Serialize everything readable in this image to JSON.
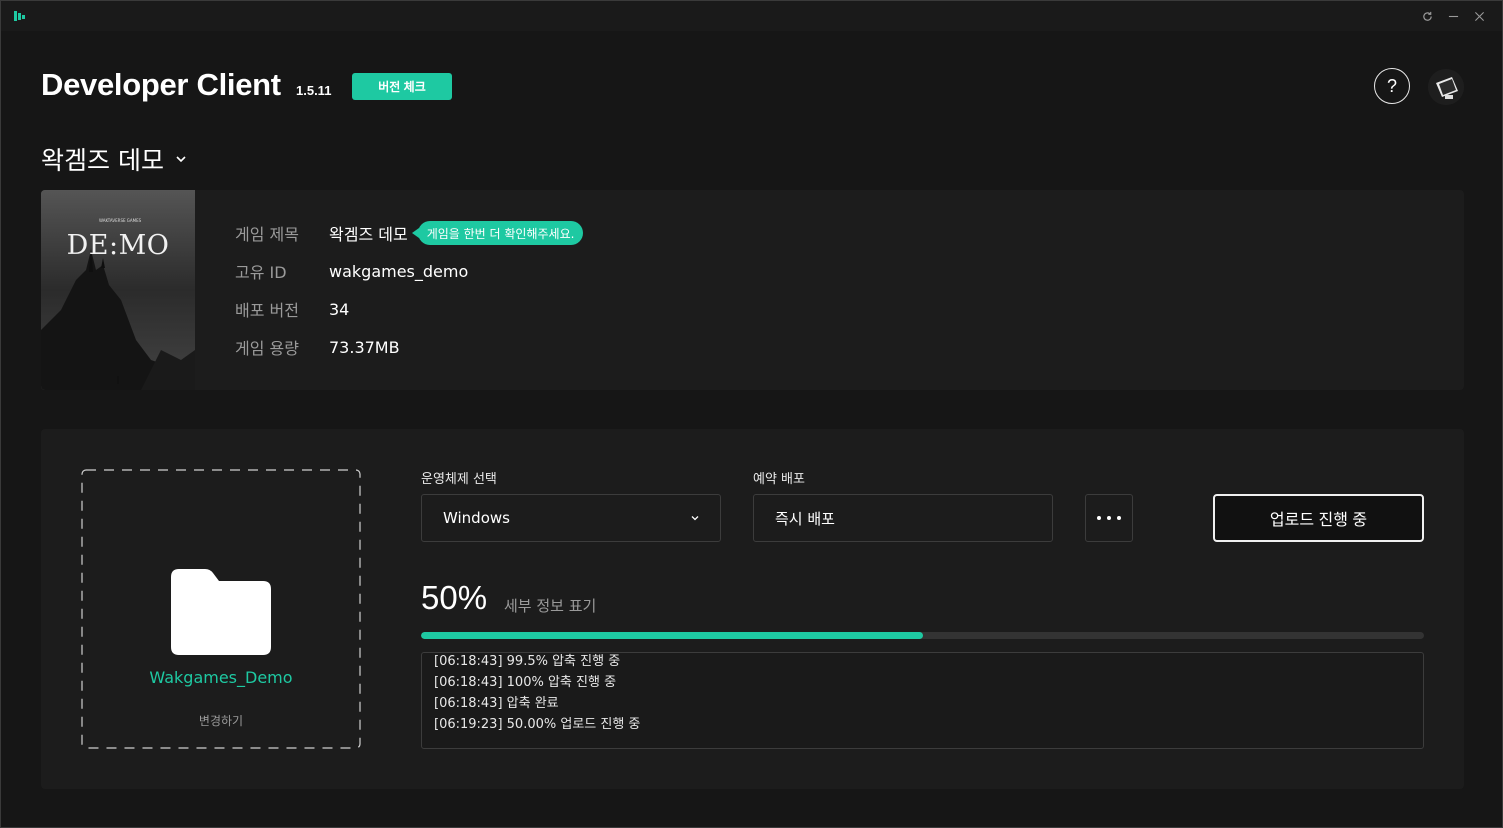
{
  "header": {
    "title": "Developer Client",
    "version": "1.5.11",
    "version_check_label": "버전 체크",
    "help_label": "?"
  },
  "project": {
    "name": "왁겜즈 데모"
  },
  "game_info": {
    "cover": {
      "title": "DE:MO",
      "brand": "WAKTAVERSE GAMES"
    },
    "rows": [
      {
        "label": "게임 제목",
        "value": "왁겜즈 데모"
      },
      {
        "label": "고유 ID",
        "value": "wakgames_demo"
      },
      {
        "label": "배포 버전",
        "value": "34"
      },
      {
        "label": "게임 용량",
        "value": "73.37MB"
      }
    ],
    "check_tip": "게임을 한번 더 확인해주세요."
  },
  "upload": {
    "folder_name": "Wakgames_Demo",
    "change_label": "변경하기",
    "os_label": "운영체제 선택",
    "os_value": "Windows",
    "schedule_label": "예약 배포",
    "schedule_value": "즉시 배포",
    "upload_button": "업로드 진행 중",
    "progress_text": "50%",
    "progress_value": 0.5,
    "detail_toggle": "세부 정보 표기",
    "log": [
      "[06:18:43] 99.5% 압축 진행 중",
      "[06:18:43] 100% 압축 진행 중",
      "[06:18:43] 압축 완료",
      "[06:19:23] 50.00% 업로드 진행 중"
    ]
  },
  "colors": {
    "accent": "#1ec9a2",
    "background": "#161616",
    "panel": "#1c1c1c"
  },
  "icons": {
    "app": "wakgames-logo-icon",
    "refresh": "refresh-icon",
    "minimize": "minimize-icon",
    "close": "close-icon",
    "folder": "folder-icon",
    "dropdown": "chevron-down-icon",
    "more": "more-dots-icon"
  }
}
